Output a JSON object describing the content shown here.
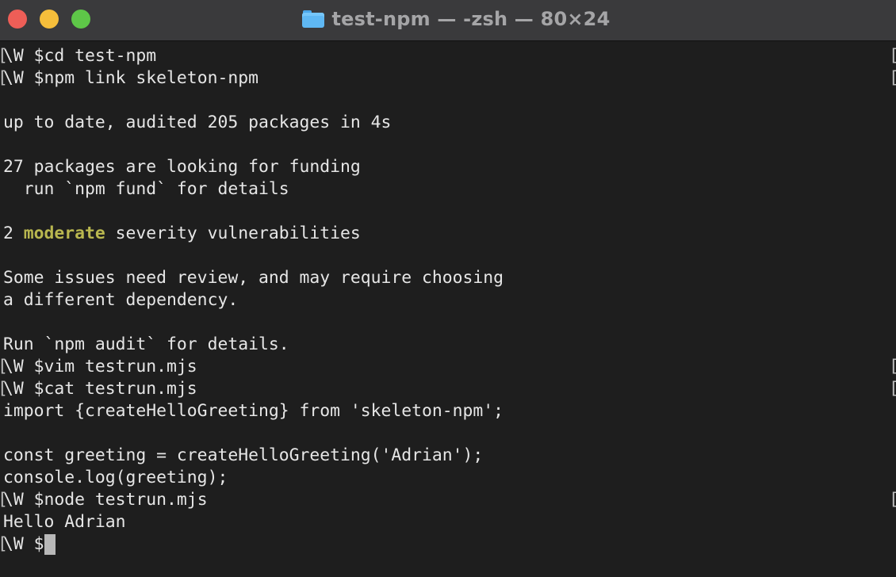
{
  "window": {
    "title": "test-npm — -zsh — 80×24",
    "folder_icon": "folder-icon"
  },
  "terminal": {
    "prompt": "\\W $",
    "bracket_left": "[",
    "bracket_right": "[",
    "lines": {
      "l1": "cd test-npm",
      "l2": "npm link skeleton-npm",
      "l3": "",
      "l4": "up to date, audited 205 packages in 4s",
      "l5": "",
      "l6": "27 packages are looking for funding",
      "l7": "  run `npm fund` for details",
      "l8": "",
      "l9_pre": "2 ",
      "l9_hl": "moderate",
      "l9_post": " severity vulnerabilities",
      "l10": "",
      "l11": "Some issues need review, and may require choosing",
      "l12": "a different dependency.",
      "l13": "",
      "l14": "Run `npm audit` for details.",
      "l15": "vim testrun.mjs",
      "l16": "cat testrun.mjs",
      "l17": "import {createHelloGreeting} from 'skeleton-npm';",
      "l18": "",
      "l19": "const greeting = createHelloGreeting('Adrian');",
      "l20": "console.log(greeting);",
      "l21": "node testrun.mjs",
      "l22": "Hello Adrian",
      "l23": ""
    }
  },
  "colors": {
    "background": "#1e1e1e",
    "text": "#e6e6e6",
    "warning": "#b9b74f",
    "close": "#ee5e57",
    "minimize": "#f6be3b",
    "zoom": "#5ec748"
  }
}
